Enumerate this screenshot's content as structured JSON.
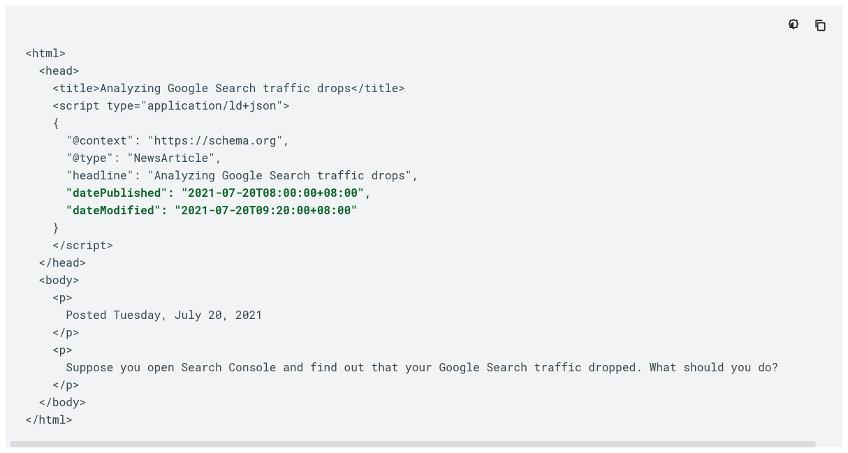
{
  "toolbar": {
    "theme_icon": "theme-toggle-icon",
    "copy_icon": "copy-icon"
  },
  "code": {
    "l01": "<html>",
    "l02": "  <head>",
    "l03_a": "    <title>",
    "l03_b": "Analyzing Google Search traffic drops",
    "l03_c": "</title>",
    "l04_a": "    <script type=",
    "l04_b": "\"application/ld+json\"",
    "l04_c": ">",
    "l05": "    {",
    "l06_a": "      \"@context\"",
    "l06_b": ": ",
    "l06_c": "\"https://schema.org\"",
    "l06_d": ",",
    "l07_a": "      \"@type\"",
    "l07_b": ": ",
    "l07_c": "\"NewsArticle\"",
    "l07_d": ",",
    "l08_a": "      \"headline\"",
    "l08_b": ": ",
    "l08_c": "\"Analyzing Google Search traffic drops\"",
    "l08_d": ",",
    "l09_a": "      \"datePublished\"",
    "l09_b": ": ",
    "l09_c": "\"2021-07-20T08:00:00+08:00\"",
    "l09_d": ",",
    "l10_a": "      \"dateModified\"",
    "l10_b": ": ",
    "l10_c": "\"2021-07-20T09:20:00+08:00\"",
    "l11": "    }",
    "l12": "    </script>",
    "l13": "  </head>",
    "l14": "  <body>",
    "l15": "    <p>",
    "l16": "      Posted Tuesday, July 20, 2021",
    "l17": "    </p>",
    "l18": "    <p>",
    "l19": "      Suppose you open Search Console and find out that your Google Search traffic dropped. What should you do?",
    "l20": "    </p>",
    "l21": "  </body>",
    "l22": "</html>"
  }
}
